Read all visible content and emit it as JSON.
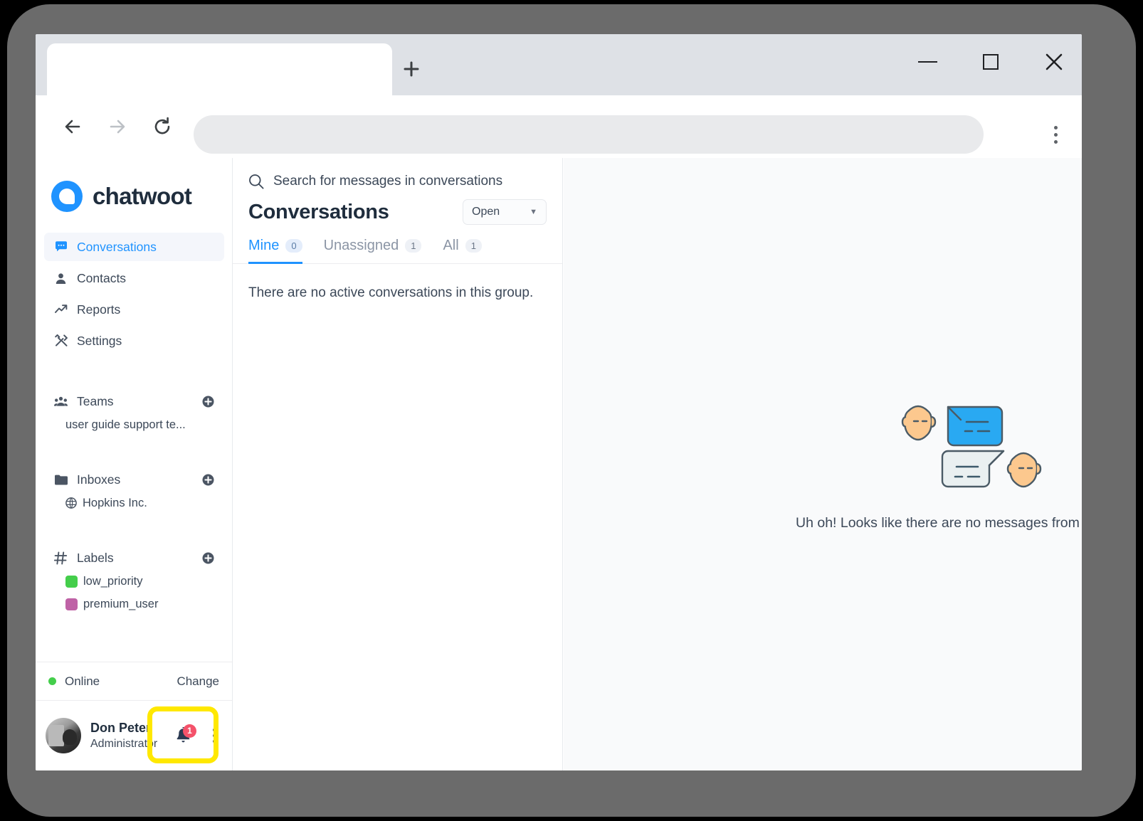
{
  "browser": {
    "tab_title": "",
    "new_tab_label": "+",
    "address_value": "",
    "address_placeholder": "",
    "back_icon": "back-arrow-icon",
    "forward_icon": "forward-arrow-icon",
    "reload_icon": "reload-icon",
    "menu_icon": "kebab-menu-icon",
    "minimize_label": "–",
    "maximize_label": "□",
    "close_label": "✕"
  },
  "app": {
    "brand": "chatwoot",
    "brand_color": "#1f93ff",
    "nav": [
      {
        "label": "Conversations",
        "icon": "chat-bubble-icon",
        "active": true
      },
      {
        "label": "Contacts",
        "icon": "person-icon",
        "active": false
      },
      {
        "label": "Reports",
        "icon": "trending-up-icon",
        "active": false
      },
      {
        "label": "Settings",
        "icon": "tools-icon",
        "active": false
      }
    ],
    "sections": [
      {
        "title": "Teams",
        "icon": "people-group-icon",
        "add_icon": "plus-circle-icon",
        "rows": [
          {
            "label": "user guide support te...",
            "icon": "",
            "color": ""
          }
        ]
      },
      {
        "title": "Inboxes",
        "icon": "folder-icon",
        "add_icon": "plus-circle-icon",
        "rows": [
          {
            "label": "Hopkins Inc.",
            "icon": "globe-icon",
            "color": ""
          }
        ]
      },
      {
        "title": "Labels",
        "icon": "hash-icon",
        "add_icon": "plus-circle-icon",
        "rows": [
          {
            "label": "low_priority",
            "icon": "color-swatch",
            "color": "#44ce4b"
          },
          {
            "label": "premium_user",
            "icon": "color-swatch",
            "color": "#bf62a6"
          }
        ]
      }
    ],
    "status": {
      "state": "Online",
      "state_color": "#44ce4b",
      "change_label": "Change"
    },
    "user": {
      "name": "Don Peter",
      "role": "Administrator",
      "avatar_icon": "user-avatar-photo",
      "bell_icon": "notification-bell-icon",
      "bell_badge": "1",
      "bell_badge_color": "#f4526a",
      "menu_icon": "vertical-kebab-icon"
    }
  },
  "conversations": {
    "search_placeholder": "Search for messages in conversations",
    "search_icon": "search-icon",
    "title": "Conversations",
    "status_filter": {
      "value": "Open",
      "caret_icon": "chevron-down-icon"
    },
    "tabs": [
      {
        "label": "Mine",
        "count": "0",
        "active": true
      },
      {
        "label": "Unassigned",
        "count": "1",
        "active": false
      },
      {
        "label": "All",
        "count": "1",
        "active": false
      }
    ],
    "empty_text": "There are no active conversations in this group."
  },
  "right_panel": {
    "illustration": "two-people-chat-bubbles-illustration",
    "empty_message": "Uh oh! Looks like there are no messages from customer"
  },
  "annotation": {
    "highlight_color": "#ffe800",
    "target": "notification-bell-button"
  }
}
